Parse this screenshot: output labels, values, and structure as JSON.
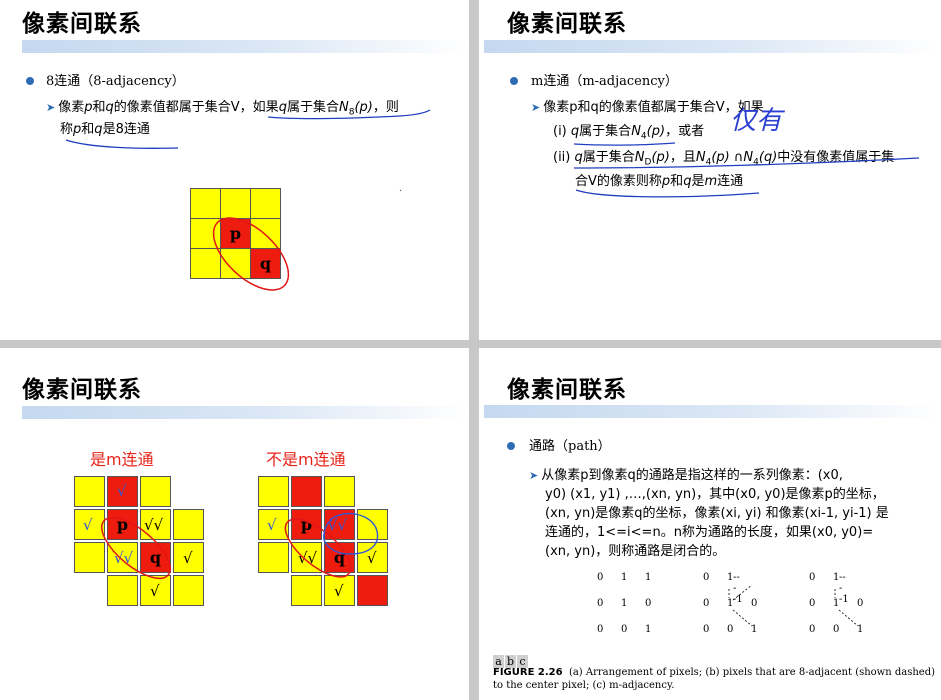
{
  "slide1": {
    "title": "像素间联系",
    "bullet": "8连通（8-adjacency）",
    "line1_a": "像素",
    "line1_p": "p",
    "line1_b": "和",
    "line1_q": "q",
    "line1_c": "的像素值都属于集合V，如果",
    "line1_q2": "q",
    "line1_d": "属于集合",
    "line1_n": "N",
    "line1_sub": "8",
    "line1_e": "(p)",
    "line1_f": "，则",
    "line2_a": "称",
    "line2_p": "p",
    "line2_b": "和",
    "line2_q": "q",
    "line2_c": "是8连通",
    "grid": {
      "p": "p",
      "q": "q"
    }
  },
  "slide2": {
    "title": "像素间联系",
    "bullet": "m连通（m-adjacency）",
    "line1": "像素p和q的像素值都属于集合V，如果",
    "i_label": "(i)",
    "i_q": "q",
    "i_text": "属于集合",
    "i_n": "N",
    "i_sub": "4",
    "i_p": "(p)",
    "i_end": "，或者",
    "handwritten": "仅有",
    "ii_label": "(ii)",
    "ii_q": "q",
    "ii_text": "属于集合",
    "ii_n": "N",
    "ii_sub": "D",
    "ii_p": "(p)",
    "ii_mid": "，且",
    "ii_n2": "N",
    "ii_sub2": "4",
    "ii_p2": "(p)",
    "ii_cap": " ∩",
    "ii_n3": "N",
    "ii_sub3": "4",
    "ii_q2": "(q)",
    "ii_end": "中没有像素值属于集",
    "ii_line2_a": "合V的像素则称",
    "ii_line2_p": "p",
    "ii_line2_b": "和",
    "ii_line2_q": "q",
    "ii_line2_c": "是",
    "ii_line2_m": "m",
    "ii_line2_d": "连通"
  },
  "slide3": {
    "title": "像素间联系",
    "caption_left": "是m连通",
    "caption_right": "不是m连通",
    "p": "p",
    "q": "q",
    "check": "√",
    "double_check": "√√"
  },
  "slide4": {
    "title": "像素间联系",
    "bullet": "通路（path）",
    "lines": [
      "从像素p到像素q的通路是指这样的一系列像素：(x0,",
      "y0) (x1, y1) ,…,(xn, yn)，其中(x0, y0)是像素p的坐标，",
      "(xn, yn)是像素q的坐标，像素(xi, yi) 和像素(xi-1, yi-1) 是",
      "连通的，1<=i<=n。n称为通路的长度，如果(x0, y0)=",
      "(xn, yn)，则称通路是闭合的。"
    ],
    "matrix_a": [
      "0",
      "1",
      "1",
      "0",
      "1",
      "0",
      "0",
      "0",
      "1"
    ],
    "matrix_b": [
      "0",
      "1",
      "----1",
      "0",
      "1",
      "0",
      "0",
      "0",
      "1"
    ],
    "matrix_c": [
      "0",
      "1",
      "----1",
      "0",
      "1",
      "0",
      "0",
      "0",
      "1"
    ],
    "fig_letters": [
      "a",
      "b",
      "c"
    ],
    "fig_label": "FIGURE 2.26",
    "fig_caption": "(a) Arrangement of pixels; (b) pixels that are 8-adjacent (shown dashed) to the center pixel; (c) m-adjacency."
  }
}
